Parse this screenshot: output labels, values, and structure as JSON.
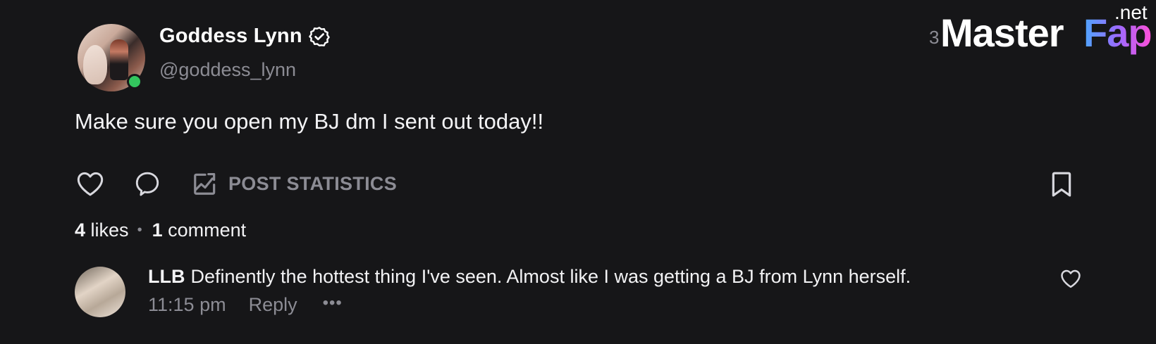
{
  "post": {
    "author_name": "Goddess Lynn",
    "author_handle": "@goddess_lynn",
    "timestamp_partial": "3",
    "text": "Make sure you open my BJ dm I sent out today!!",
    "actions": {
      "stats_label": "POST STATISTICS"
    },
    "likes_count": "4",
    "likes_label": "likes",
    "comments_count": "1",
    "comments_label": "comment",
    "separator": "•"
  },
  "comment": {
    "author": "LLB",
    "text": "Definently the hottest thing I've seen. Almost like I was getting a BJ from Lynn herself.",
    "time": "11:15 pm",
    "reply_label": "Reply",
    "more_label": "•••"
  },
  "watermark": {
    "part1": "Master",
    "part2": "Fap",
    "suffix": ".net"
  },
  "colors": {
    "background": "#161618",
    "online": "#33c65e",
    "muted": "#8c8c94"
  },
  "icons": {
    "like": "heart-icon",
    "comment": "comment-bubble-icon",
    "stats": "chart-image-icon",
    "bookmark": "bookmark-icon",
    "verified": "verified-badge-icon"
  }
}
